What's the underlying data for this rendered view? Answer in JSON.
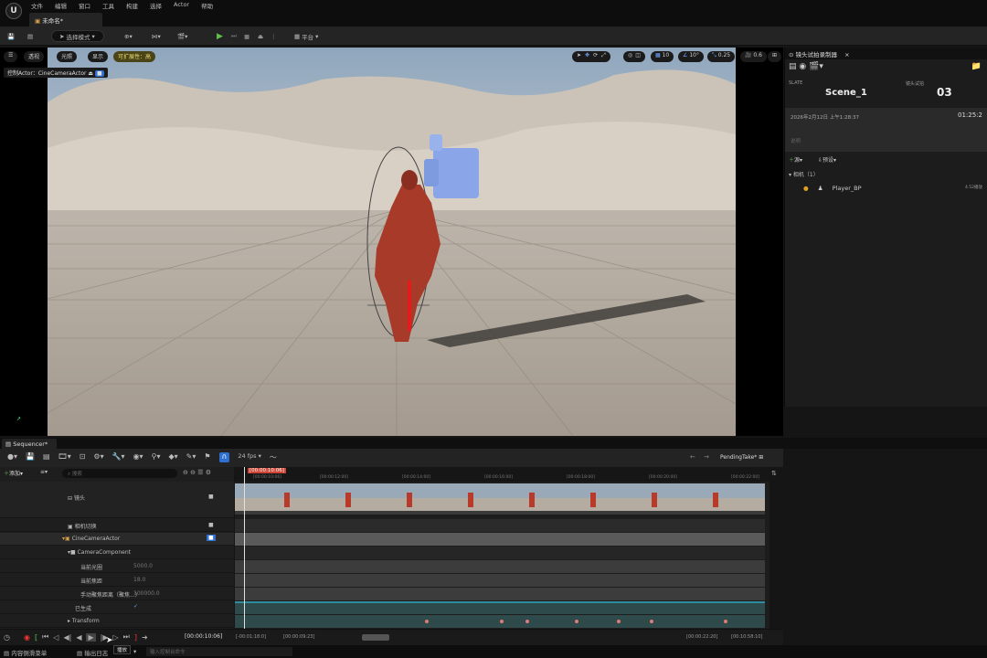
{
  "menubar": {
    "items": [
      "文件",
      "编辑",
      "窗口",
      "工具",
      "构建",
      "选择",
      "Actor",
      "帮助"
    ]
  },
  "tab": {
    "label": "未命名*"
  },
  "toolbar": {
    "select_mode": "选择模式",
    "platform": "平台"
  },
  "viewport": {
    "perspective": "透视",
    "lit": "光照",
    "show": "显示",
    "scalability": "可扩展性：高",
    "pilot": "控制Actor：CineCameraActor",
    "grid_size": "10",
    "rot_snap": "10°",
    "scale_snap": "0.25",
    "cam_speed": "0.6"
  },
  "outliner": {
    "title": "镜头试拍录制器",
    "slate_label": "SLATE",
    "slate_value": "Scene_1",
    "take_label": "镜头试拍",
    "take_value": "03",
    "datetime": "2026年2月12日 上午1:28:37",
    "timecode": "01:25:2",
    "description_placeholder": "说明",
    "add_label": "源",
    "preset_label": "预设",
    "group_label": "相机（1）",
    "source_name": "Player_BP",
    "source_meta": "4.52播放"
  },
  "sequencer": {
    "tab": "Sequencer*",
    "fps": "24 fps",
    "pending": "PendingTake*",
    "add": "添加",
    "search_placeholder": "搜索",
    "playhead": "[00:00:10:06]",
    "ticks": [
      "[00:00:10:06]",
      "[00:00:12:00]",
      "[00:00:14:00]",
      "[00:00:16:00]",
      "[00:00:18:00]",
      "[00:00:20:00]",
      "[00:00:22:00]"
    ],
    "tracks": [
      {
        "label": "镜头",
        "icon": "shot-icon"
      },
      {
        "label": "相机切换",
        "icon": "camera-cut-icon"
      },
      {
        "label": "CineCameraActor",
        "icon": "actor-icon"
      },
      {
        "label": "CameraComponent",
        "icon": "component-icon"
      },
      {
        "label": "当前光圈",
        "value": "5000.0"
      },
      {
        "label": "当前焦距",
        "value": "18.0"
      },
      {
        "label": "手动聚焦距离（聚焦...）",
        "value": "100000.0"
      },
      {
        "label": "已生成"
      },
      {
        "label": "Transform"
      }
    ],
    "current_time": "[00:00:10:06]",
    "range_start": "[-00:01:18:0]",
    "range_mid": "[00:00:09:23]",
    "range_end_left": "[00:00:22:20]",
    "range_end_right": "[00:10:58:10]",
    "tooltip": "播放"
  },
  "status": {
    "content_browser": "内容侧滑菜单",
    "output_log": "输出日志",
    "cmd_placeholder": "输入控制台命令"
  }
}
